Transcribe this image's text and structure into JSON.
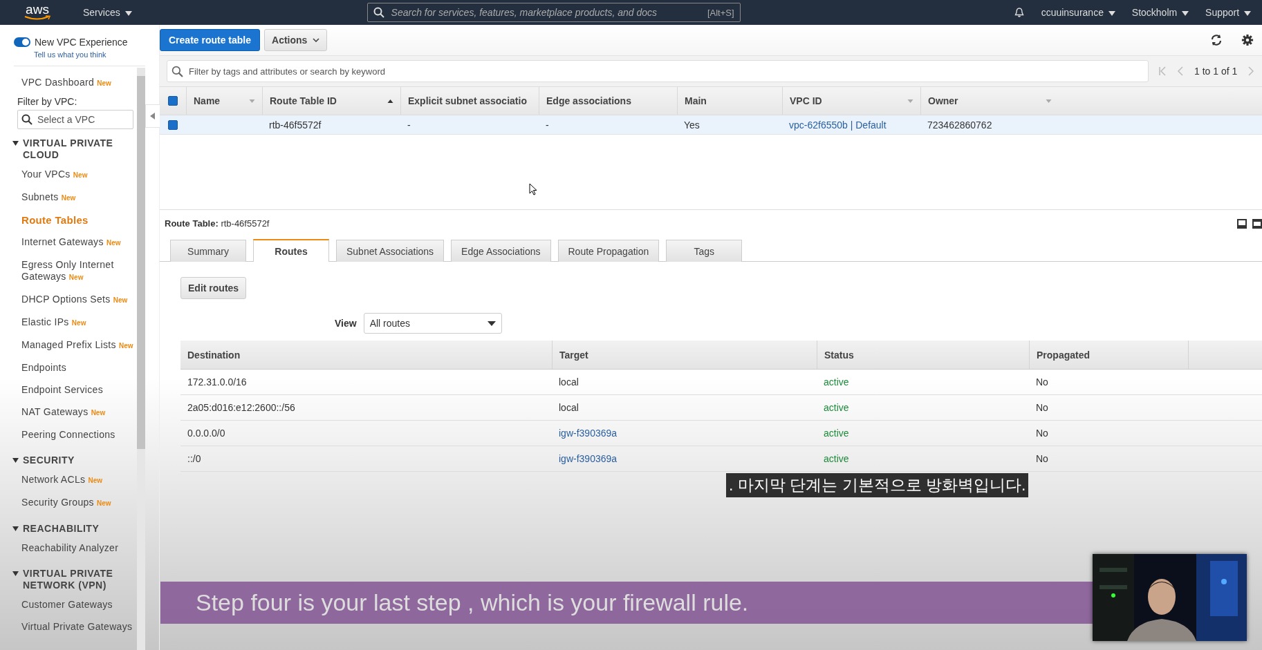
{
  "top_bar": {
    "logo": "aws",
    "services": "Services",
    "search": {
      "placeholder": "Search for services, features, marketplace products, and docs",
      "shortcut": "[Alt+S]"
    },
    "account": "ccuuinsurance",
    "region": "Stockholm",
    "support": "Support"
  },
  "sidebar": {
    "toggle": {
      "label": "New VPC Experience",
      "on": true,
      "link": "Tell us what you think"
    },
    "dashboard": {
      "label": "VPC Dashboard",
      "badge": "New"
    },
    "filter": {
      "label": "Filter by VPC:",
      "placeholder": "Select a VPC"
    },
    "sections": [
      {
        "title": "VIRTUAL PRIVATE CLOUD",
        "expanded": true,
        "items": [
          {
            "label": "Your VPCs",
            "badge": "New",
            "selected": false
          },
          {
            "label": "Subnets",
            "badge": "New",
            "selected": false
          },
          {
            "label": "Route Tables",
            "selected": true
          },
          {
            "label": "Internet Gateways",
            "badge": "New",
            "selected": false
          },
          {
            "label": "Egress Only Internet Gateways",
            "badge": "New",
            "selected": false
          },
          {
            "label": "DHCP Options Sets",
            "badge": "New",
            "selected": false
          },
          {
            "label": "Elastic IPs",
            "badge": "New",
            "selected": false
          },
          {
            "label": "Managed Prefix Lists",
            "badge": "New",
            "selected": false
          },
          {
            "label": "Endpoints",
            "selected": false
          },
          {
            "label": "Endpoint Services",
            "selected": false
          },
          {
            "label": "NAT Gateways",
            "badge": "New",
            "selected": false
          },
          {
            "label": "Peering Connections",
            "selected": false
          }
        ]
      },
      {
        "title": "SECURITY",
        "expanded": true,
        "items": [
          {
            "label": "Network ACLs",
            "badge": "New",
            "selected": false
          },
          {
            "label": "Security Groups",
            "badge": "New",
            "selected": false
          }
        ]
      },
      {
        "title": "REACHABILITY",
        "expanded": true,
        "items": [
          {
            "label": "Reachability Analyzer",
            "selected": false
          }
        ]
      },
      {
        "title": "VIRTUAL PRIVATE NETWORK (VPN)",
        "expanded": true,
        "items": [
          {
            "label": "Customer Gateways",
            "selected": false
          },
          {
            "label": "Virtual Private Gateways",
            "selected": false
          }
        ]
      }
    ]
  },
  "toolbar": {
    "create": "Create route table",
    "actions": "Actions"
  },
  "filter": {
    "placeholder": "Filter by tags and attributes or search by keyword",
    "pagination": "1 to 1 of 1"
  },
  "table": {
    "all_checked": true,
    "columns": [
      {
        "label": "Name",
        "sortable": true,
        "sorted": false
      },
      {
        "label": "Route Table ID",
        "sortable": true,
        "sorted": true
      },
      {
        "label": "Explicit subnet associatio"
      },
      {
        "label": "Edge associations"
      },
      {
        "label": "Main"
      },
      {
        "label": "VPC ID",
        "sortable": true,
        "sorted": false
      },
      {
        "label": "Owner",
        "sortable": true,
        "sorted": false
      }
    ],
    "rows": [
      {
        "selected": true,
        "cells": [
          null,
          {
            "text": "rtb-46f5572f"
          },
          {
            "text": "-"
          },
          {
            "text": "-"
          },
          {
            "text": "Yes"
          },
          {
            "text": "vpc-62f6550b | Default",
            "link": true
          },
          {
            "text": "723462860762"
          }
        ]
      }
    ]
  },
  "details": {
    "label": "Route Table:",
    "value": "rtb-46f5572f",
    "tabs": [
      {
        "label": "Summary",
        "selected": false
      },
      {
        "label": "Routes",
        "selected": true
      },
      {
        "label": "Subnet Associations",
        "selected": false
      },
      {
        "label": "Edge Associations",
        "selected": false
      },
      {
        "label": "Route Propagation",
        "selected": false
      },
      {
        "label": "Tags",
        "selected": false
      }
    ],
    "edit": "Edit routes",
    "view": {
      "label": "View",
      "value": "All routes"
    },
    "routes": {
      "columns": [
        "Destination",
        "Target",
        "Status",
        "Propagated"
      ],
      "rows": [
        {
          "destination": "172.31.0.0/16",
          "target": "local",
          "target_link": false,
          "status": "active",
          "propagated": "No"
        },
        {
          "destination": "2a05:d016:e12:2600::/56",
          "target": "local",
          "target_link": false,
          "status": "active",
          "propagated": "No"
        },
        {
          "destination": "0.0.0.0/0",
          "target": "igw-f390369a",
          "target_link": true,
          "status": "active",
          "propagated": "No"
        },
        {
          "destination": "::/0",
          "target": "igw-f390369a",
          "target_link": true,
          "status": "active",
          "propagated": "No"
        }
      ]
    }
  },
  "captions": {
    "korean": ". 마지막 단계는 기본적으로 방화벽입니다.",
    "english": "Step four is your last step , which is your firewall rule."
  }
}
